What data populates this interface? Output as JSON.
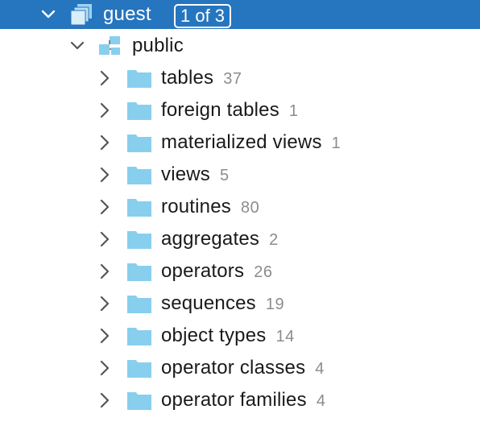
{
  "tree": {
    "root": {
      "label": "guest",
      "badge": "1 of 3",
      "expanded": true,
      "icon": "database-stack-icon"
    },
    "schema": {
      "label": "public",
      "expanded": true,
      "icon": "schema-icon"
    },
    "folders": [
      {
        "label": "tables",
        "count": "37"
      },
      {
        "label": "foreign tables",
        "count": "1"
      },
      {
        "label": "materialized views",
        "count": "1"
      },
      {
        "label": "views",
        "count": "5"
      },
      {
        "label": "routines",
        "count": "80"
      },
      {
        "label": "aggregates",
        "count": "2"
      },
      {
        "label": "operators",
        "count": "26"
      },
      {
        "label": "sequences",
        "count": "19"
      },
      {
        "label": "object types",
        "count": "14"
      },
      {
        "label": "operator classes",
        "count": "4"
      },
      {
        "label": "operator families",
        "count": "4"
      }
    ]
  },
  "colors": {
    "selection": "#2675bf",
    "folder": "#88cfee",
    "count": "#8c8c8c"
  }
}
